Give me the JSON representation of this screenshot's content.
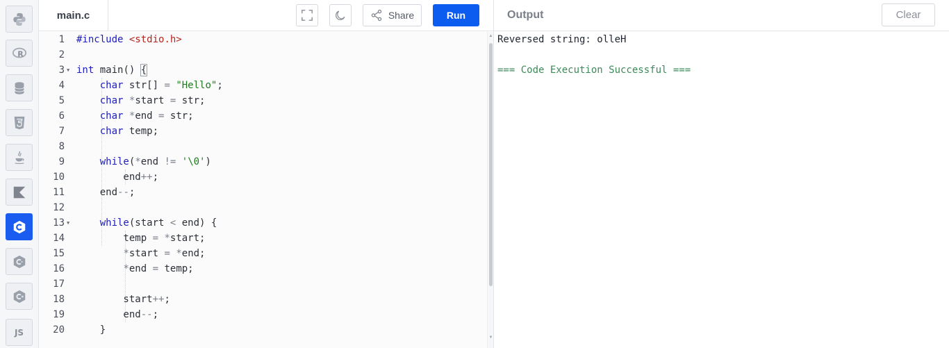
{
  "sidebar": {
    "languages": [
      {
        "name": "python-icon"
      },
      {
        "name": "r-icon"
      },
      {
        "name": "sql-icon"
      },
      {
        "name": "html-icon"
      },
      {
        "name": "java-icon"
      },
      {
        "name": "kotlin-icon"
      },
      {
        "name": "c-icon",
        "active": true
      },
      {
        "name": "cpp-icon"
      },
      {
        "name": "csharp-icon"
      },
      {
        "name": "js-icon",
        "label": "JS"
      }
    ]
  },
  "editor": {
    "file_name": "main.c",
    "share_label": "Share",
    "run_label": "Run",
    "line_numbers": [
      "1",
      "2",
      "3",
      "4",
      "5",
      "6",
      "7",
      "8",
      "9",
      "10",
      "11",
      "12",
      "13",
      "14",
      "15",
      "16",
      "17",
      "18",
      "19",
      "20"
    ]
  },
  "output": {
    "title": "Output",
    "clear_label": "Clear",
    "lines": [
      "Reversed string: olleH",
      "",
      "=== Code Execution Successful ==="
    ]
  },
  "colors": {
    "accent": "#0d5cf0",
    "active_lang": "#1a5cf0",
    "keyword": "#1d1dbb",
    "string": "#1e7a1e",
    "success": "#3c8a5a"
  }
}
